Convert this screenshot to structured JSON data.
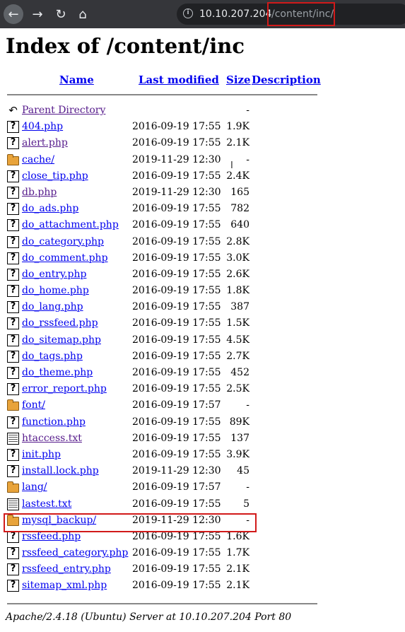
{
  "browser": {
    "url_host": "10.10.207.204",
    "url_path": "/content/inc/",
    "icons": {
      "back": "back-arrow-icon",
      "forward": "forward-arrow-icon",
      "reload": "reload-icon",
      "home": "home-icon",
      "info": "info-icon"
    }
  },
  "page": {
    "title": "Index of /content/inc",
    "columns": {
      "name": "Name",
      "last_modified": "Last modified",
      "size": "Size",
      "description": "Description"
    },
    "entries": [
      {
        "name": "Parent Directory",
        "date": "",
        "size": "-",
        "icon": "back-icon",
        "visited": true
      },
      {
        "name": "404.php",
        "date": "2016-09-19 17:55",
        "size": "1.9K",
        "icon": "unknown-file-icon"
      },
      {
        "name": "alert.php",
        "date": "2016-09-19 17:55",
        "size": "2.1K",
        "icon": "unknown-file-icon",
        "visited": true
      },
      {
        "name": "cache/",
        "date": "2019-11-29 12:30",
        "size": "-",
        "icon": "folder-icon"
      },
      {
        "name": "close_tip.php",
        "date": "2016-09-19 17:55",
        "size": "2.4K",
        "icon": "unknown-file-icon"
      },
      {
        "name": "db.php",
        "date": "2019-11-29 12:30",
        "size": "165",
        "icon": "unknown-file-icon",
        "visited": true
      },
      {
        "name": "do_ads.php",
        "date": "2016-09-19 17:55",
        "size": "782",
        "icon": "unknown-file-icon"
      },
      {
        "name": "do_attachment.php",
        "date": "2016-09-19 17:55",
        "size": "640",
        "icon": "unknown-file-icon"
      },
      {
        "name": "do_category.php",
        "date": "2016-09-19 17:55",
        "size": "2.8K",
        "icon": "unknown-file-icon"
      },
      {
        "name": "do_comment.php",
        "date": "2016-09-19 17:55",
        "size": "3.0K",
        "icon": "unknown-file-icon"
      },
      {
        "name": "do_entry.php",
        "date": "2016-09-19 17:55",
        "size": "2.6K",
        "icon": "unknown-file-icon"
      },
      {
        "name": "do_home.php",
        "date": "2016-09-19 17:55",
        "size": "1.8K",
        "icon": "unknown-file-icon"
      },
      {
        "name": "do_lang.php",
        "date": "2016-09-19 17:55",
        "size": "387",
        "icon": "unknown-file-icon"
      },
      {
        "name": "do_rssfeed.php",
        "date": "2016-09-19 17:55",
        "size": "1.5K",
        "icon": "unknown-file-icon"
      },
      {
        "name": "do_sitemap.php",
        "date": "2016-09-19 17:55",
        "size": "4.5K",
        "icon": "unknown-file-icon"
      },
      {
        "name": "do_tags.php",
        "date": "2016-09-19 17:55",
        "size": "2.7K",
        "icon": "unknown-file-icon"
      },
      {
        "name": "do_theme.php",
        "date": "2016-09-19 17:55",
        "size": "452",
        "icon": "unknown-file-icon"
      },
      {
        "name": "error_report.php",
        "date": "2016-09-19 17:55",
        "size": "2.5K",
        "icon": "unknown-file-icon"
      },
      {
        "name": "font/",
        "date": "2016-09-19 17:57",
        "size": "-",
        "icon": "folder-icon"
      },
      {
        "name": "function.php",
        "date": "2016-09-19 17:55",
        "size": "89K",
        "icon": "unknown-file-icon"
      },
      {
        "name": "htaccess.txt",
        "date": "2016-09-19 17:55",
        "size": "137",
        "icon": "text-file-icon",
        "visited": true
      },
      {
        "name": "init.php",
        "date": "2016-09-19 17:55",
        "size": "3.9K",
        "icon": "unknown-file-icon"
      },
      {
        "name": "install.lock.php",
        "date": "2019-11-29 12:30",
        "size": "45",
        "icon": "unknown-file-icon"
      },
      {
        "name": "lang/",
        "date": "2016-09-19 17:57",
        "size": "-",
        "icon": "folder-icon"
      },
      {
        "name": "lastest.txt",
        "date": "2016-09-19 17:55",
        "size": "5",
        "icon": "text-file-icon"
      },
      {
        "name": "mysql_backup/",
        "date": "2019-11-29 12:30",
        "size": "-",
        "icon": "folder-icon",
        "highlighted": true
      },
      {
        "name": "rssfeed.php",
        "date": "2016-09-19 17:55",
        "size": "1.6K",
        "icon": "unknown-file-icon"
      },
      {
        "name": "rssfeed_category.php",
        "date": "2016-09-19 17:55",
        "size": "1.7K",
        "icon": "unknown-file-icon"
      },
      {
        "name": "rssfeed_entry.php",
        "date": "2016-09-19 17:55",
        "size": "2.1K",
        "icon": "unknown-file-icon"
      },
      {
        "name": "sitemap_xml.php",
        "date": "2016-09-19 17:55",
        "size": "2.1K",
        "icon": "unknown-file-icon"
      }
    ],
    "footer": "Apache/2.4.18 (Ubuntu) Server at 10.10.207.204 Port 80"
  },
  "colors": {
    "link": "#0000ee",
    "visited_link": "#551a8b",
    "highlight": "#d11a1a",
    "chrome_bg": "#35363a"
  }
}
